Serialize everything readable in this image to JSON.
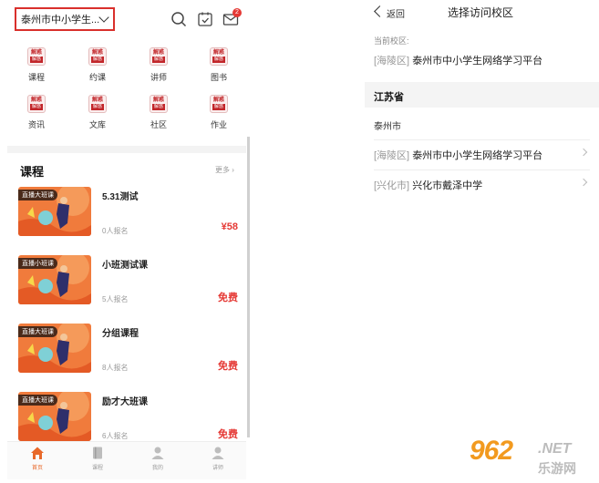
{
  "left": {
    "campus_select": "泰州市中小学生...",
    "badge_count": "2",
    "grid": [
      {
        "icon": "jiehuo-icon",
        "label": "课程"
      },
      {
        "icon": "jiehuo-icon",
        "label": "约课"
      },
      {
        "icon": "jiehuo-icon",
        "label": "讲师"
      },
      {
        "icon": "jiehuo-icon",
        "label": "图书"
      },
      {
        "icon": "jiehuo-icon",
        "label": "资讯"
      },
      {
        "icon": "jiehuo-icon",
        "label": "文库"
      },
      {
        "icon": "jiehuo-icon",
        "label": "社区"
      },
      {
        "icon": "jiehuo-icon",
        "label": "作业"
      }
    ],
    "grid_icon_text_top": "解惑",
    "grid_icon_text_bottom": "解惑",
    "section_title": "课程",
    "section_more": "更多",
    "courses": [
      {
        "tag": "直播大班课",
        "title": "5.31测试",
        "enroll": "0人报名",
        "price": "¥58"
      },
      {
        "tag": "直播小班课",
        "title": "小班测试课",
        "enroll": "5人报名",
        "price": "免费"
      },
      {
        "tag": "直播大班课",
        "title": "分组课程",
        "enroll": "8人报名",
        "price": "免费"
      },
      {
        "tag": "直播大班课",
        "title": "励才大班课",
        "enroll": "6人报名",
        "price": "免费"
      }
    ],
    "tabs": [
      {
        "label": "首页",
        "active": true
      },
      {
        "label": "课程",
        "active": false
      },
      {
        "label": "我的",
        "active": false
      },
      {
        "label": "讲师",
        "active": false
      }
    ],
    "accent": "#e8692a",
    "highlight_border": "#d9302c",
    "price_color": "#e53935"
  },
  "right": {
    "back_label": "返回",
    "title": "选择访问校区",
    "current_label": "当前校区:",
    "current_district": "[海陵区]",
    "current_school": "泰州市中小学生网络学习平台",
    "province": "江苏省",
    "city": "泰州市",
    "schools": [
      {
        "district": "[海陵区]",
        "name": "泰州市中小学生网络学习平台"
      },
      {
        "district": "[兴化市]",
        "name": "兴化市戴泽中学"
      }
    ]
  },
  "watermark": {
    "num": "962",
    "net": ".NET",
    "cn": "乐游网"
  }
}
